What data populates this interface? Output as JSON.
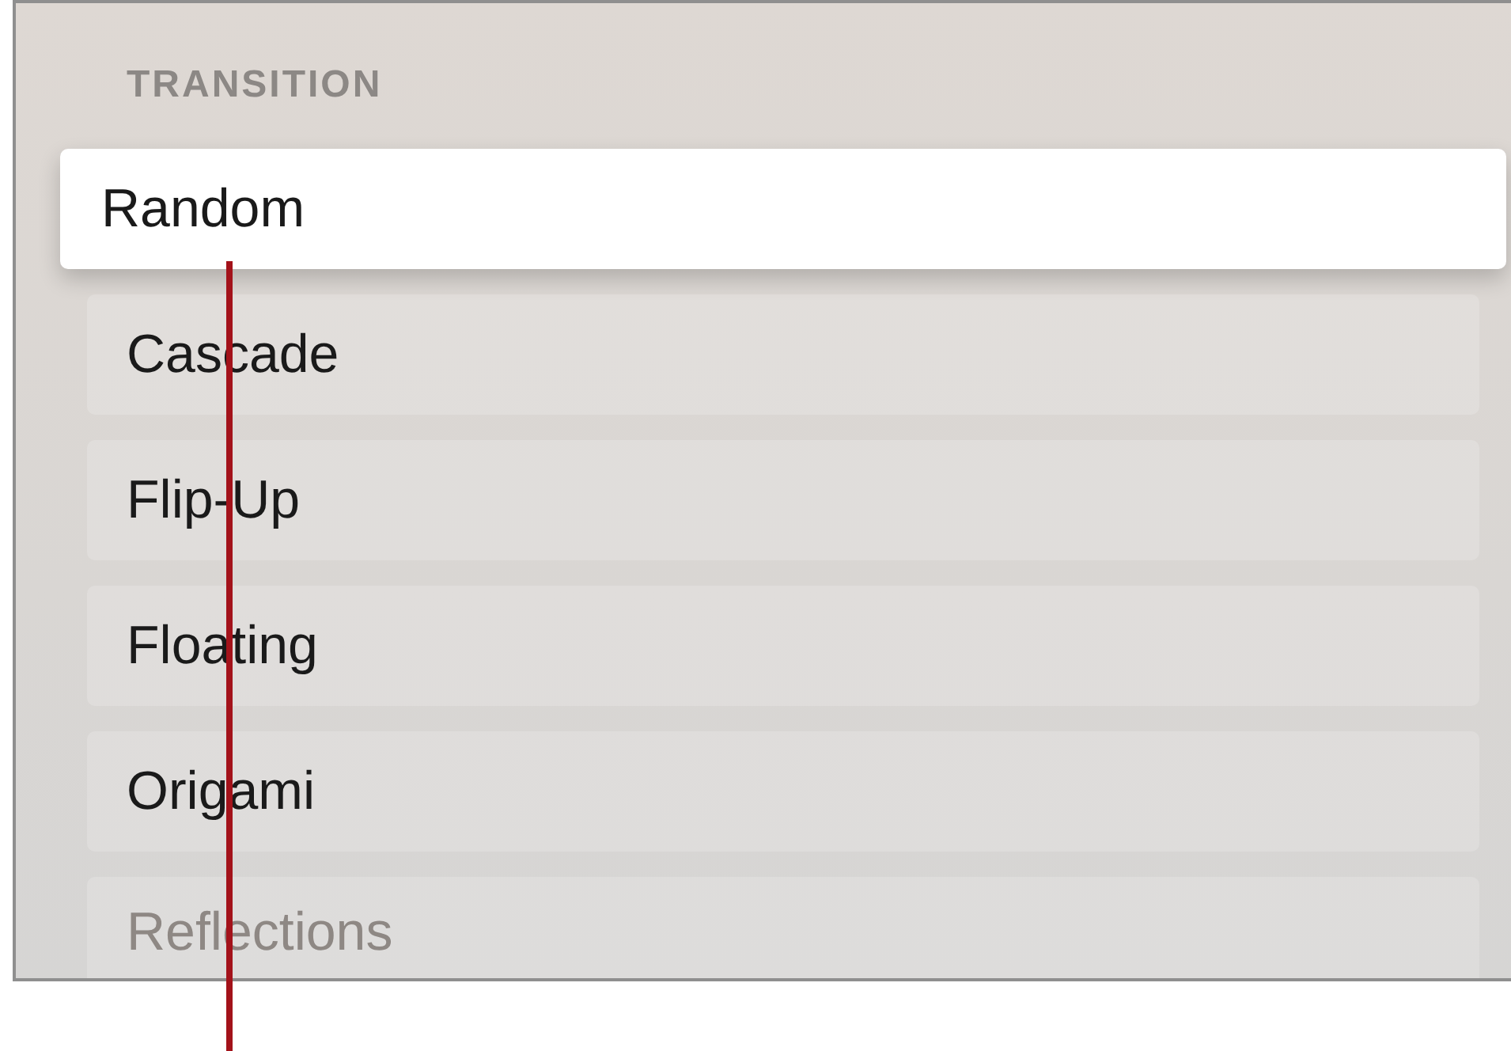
{
  "section": {
    "title": "TRANSITION"
  },
  "items": [
    {
      "label": "Random",
      "selected": true,
      "faded": false
    },
    {
      "label": "Cascade",
      "selected": false,
      "faded": false
    },
    {
      "label": "Flip-Up",
      "selected": false,
      "faded": false
    },
    {
      "label": "Floating",
      "selected": false,
      "faded": false
    },
    {
      "label": "Origami",
      "selected": false,
      "faded": false
    },
    {
      "label": "Reflections",
      "selected": false,
      "faded": true
    }
  ]
}
